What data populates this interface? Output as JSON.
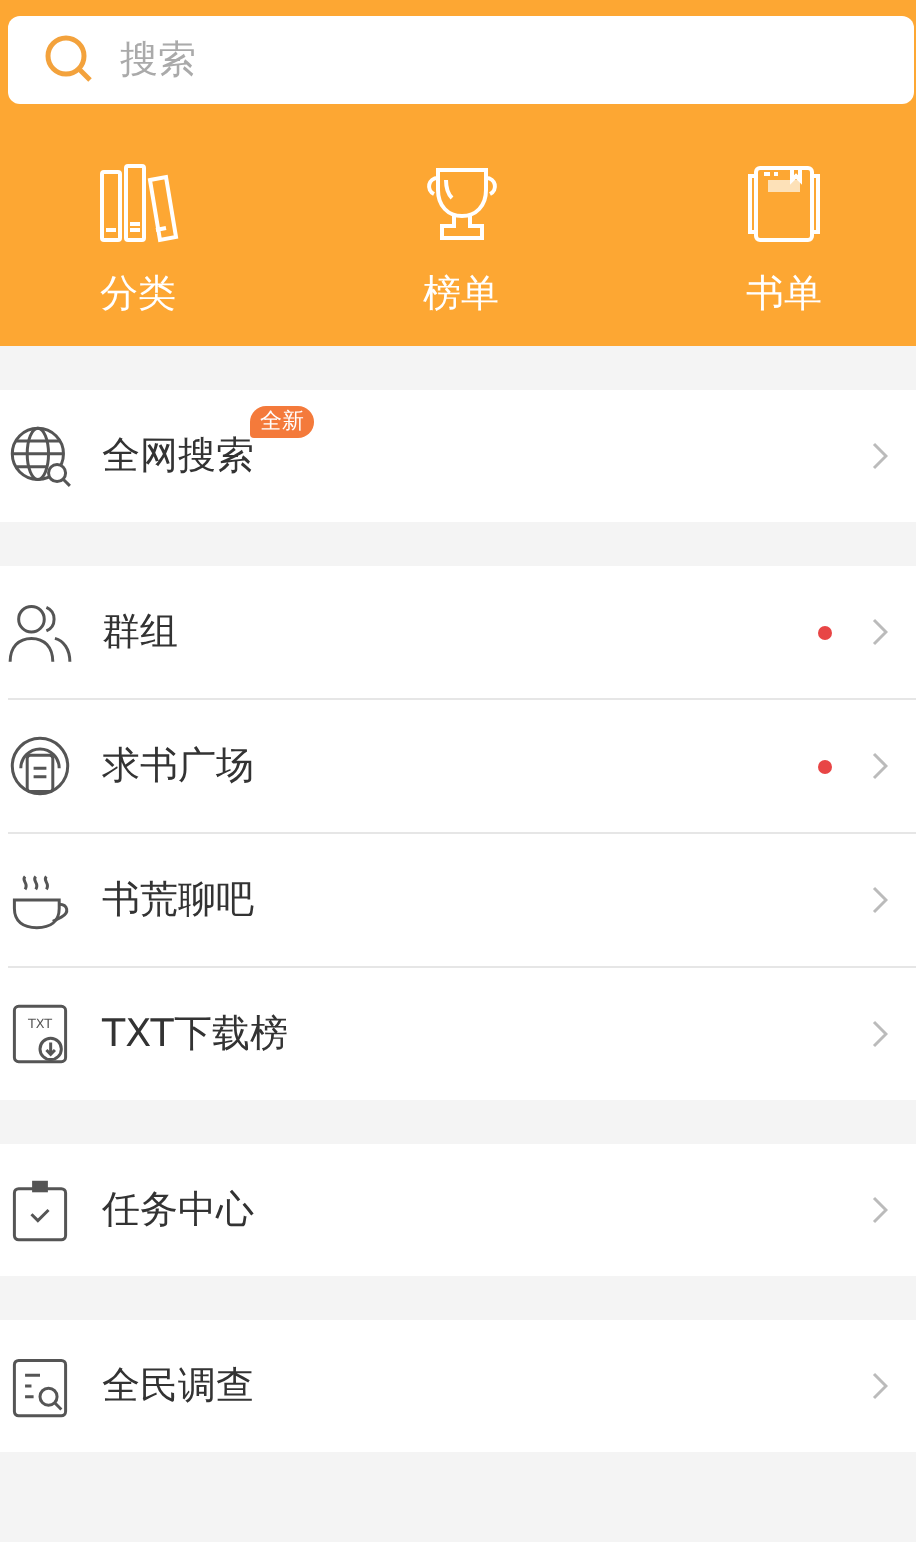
{
  "search": {
    "placeholder": "搜索"
  },
  "shortcuts": [
    {
      "kind": "books",
      "label": "分类"
    },
    {
      "kind": "trophy",
      "label": "榜单"
    },
    {
      "kind": "notebook",
      "label": "书单"
    }
  ],
  "groups": [
    {
      "items": [
        {
          "kind": "globe",
          "label": "全网搜索",
          "badge": "全新",
          "unread": false
        }
      ]
    },
    {
      "items": [
        {
          "kind": "people",
          "label": "群组",
          "unread": true
        },
        {
          "kind": "headset",
          "label": "求书广场",
          "unread": true
        },
        {
          "kind": "coffee",
          "label": "书荒聊吧",
          "unread": false
        },
        {
          "kind": "txt",
          "label": "TXT下载榜",
          "icon_text": "TXT",
          "unread": false
        }
      ]
    },
    {
      "items": [
        {
          "kind": "clipboard",
          "label": "任务中心",
          "unread": false
        }
      ]
    },
    {
      "items": [
        {
          "kind": "survey",
          "label": "全民调查",
          "unread": false
        }
      ]
    }
  ]
}
